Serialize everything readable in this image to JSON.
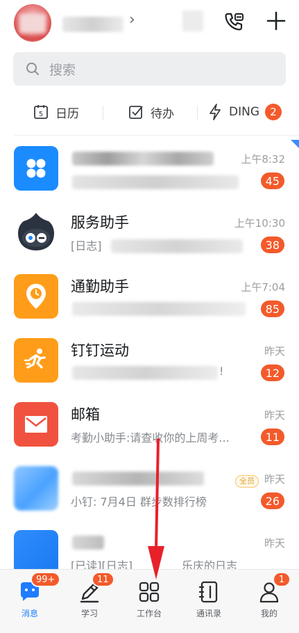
{
  "header": {
    "chevron": "›",
    "icons": [
      "phone-callback-icon",
      "plus-icon"
    ]
  },
  "search": {
    "placeholder": "搜索"
  },
  "quickbar": {
    "calendar": {
      "label": "日历",
      "icon_text": "5"
    },
    "todo": {
      "label": "待办"
    },
    "ding": {
      "label": "DING",
      "badge": "2"
    }
  },
  "chats": [
    {
      "title": "",
      "subtitle": "",
      "time": "上午8:32",
      "badge": "45"
    },
    {
      "title": "服务助手",
      "subtitle": "[日志]",
      "time": "上午10:30",
      "badge": "38"
    },
    {
      "title": "通勤助手",
      "subtitle": "",
      "time": "上午7:04",
      "badge": "85"
    },
    {
      "title": "钉钉运动",
      "subtitle": "!",
      "time": "昨天",
      "badge": "12"
    },
    {
      "title": "邮箱",
      "subtitle": "考勤小助手:请查收你的上周考...",
      "time": "昨天",
      "badge": "11"
    },
    {
      "title": "",
      "subtitle": "小钉: 7月4日 群步数排行榜",
      "time": "昨天",
      "badge": "26",
      "tag": "全员"
    },
    {
      "title": "",
      "subtitle": "[已读][日志]",
      "subtitle2": "乐庆的日志",
      "time": "昨天"
    }
  ],
  "tabs": [
    {
      "label": "消息",
      "badge": "99+"
    },
    {
      "label": "学习",
      "badge": "11"
    },
    {
      "label": "工作台"
    },
    {
      "label": "通讯录"
    },
    {
      "label": "我的",
      "badge": "1"
    }
  ],
  "colors": {
    "accent": "#1f7cff",
    "badge": "#f35a2b",
    "annotation": "#e8202a"
  }
}
